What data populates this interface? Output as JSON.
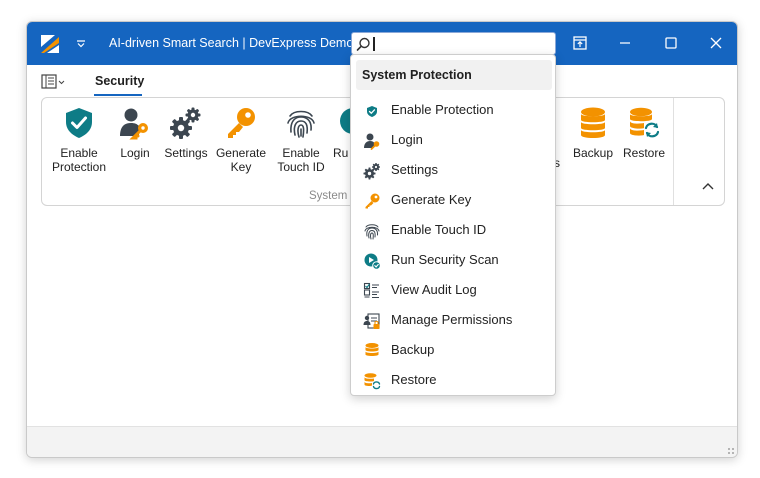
{
  "window": {
    "title": "AI-driven Smart Search | DevExpress Demo",
    "search": {
      "value": "",
      "placeholder": ""
    }
  },
  "tabs": [
    {
      "label": "Security",
      "active": true
    }
  ],
  "ribbon": {
    "group_label": "System",
    "buttons": [
      {
        "line1": "Enable",
        "line2": "Protection",
        "icon": "shield-check-icon"
      },
      {
        "line1": "Login",
        "line2": "",
        "icon": "user-key-icon"
      },
      {
        "line1": "Settings",
        "line2": "",
        "icon": "gears-icon"
      },
      {
        "line1": "Generate",
        "line2": "Key",
        "icon": "key-icon"
      },
      {
        "line1": "Enable",
        "line2": "Touch ID",
        "icon": "fingerprint-icon"
      },
      {
        "line1": "Ru",
        "line2": "",
        "icon": "scan-icon"
      },
      {
        "line1": "s",
        "line2": "",
        "icon": ""
      },
      {
        "line1": "Backup",
        "line2": "",
        "icon": "database-icon"
      },
      {
        "line1": "Restore",
        "line2": "",
        "icon": "database-restore-icon"
      }
    ]
  },
  "dropdown": {
    "header": "System Protection",
    "items": [
      {
        "label": "Enable Protection",
        "icon": "shield-check-icon"
      },
      {
        "label": "Login",
        "icon": "user-key-icon"
      },
      {
        "label": "Settings",
        "icon": "gears-icon"
      },
      {
        "label": "Generate Key",
        "icon": "key-icon"
      },
      {
        "label": "Enable Touch ID",
        "icon": "fingerprint-icon"
      },
      {
        "label": "Run Security Scan",
        "icon": "scan-icon"
      },
      {
        "label": "View Audit Log",
        "icon": "checklist-icon"
      },
      {
        "label": "Manage Permissions",
        "icon": "permissions-icon"
      },
      {
        "label": "Backup",
        "icon": "database-icon"
      },
      {
        "label": "Restore",
        "icon": "database-restore-icon"
      }
    ]
  },
  "colors": {
    "titlebar": "#1565c0",
    "teal": "#0e7c86",
    "orange": "#f39200",
    "dark_icon": "#3c4650"
  }
}
